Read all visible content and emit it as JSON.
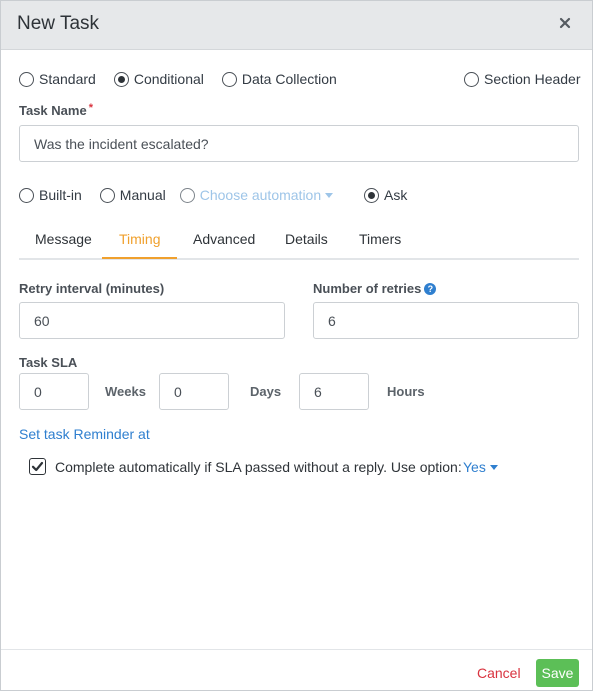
{
  "dialog": {
    "title": "New Task"
  },
  "task_type": {
    "options": [
      "Standard",
      "Conditional",
      "Data Collection",
      "Section Header"
    ],
    "selected": "Conditional"
  },
  "task_name": {
    "label": "Task Name",
    "required_mark": "*",
    "value": "Was the incident escalated?"
  },
  "mode": {
    "options": [
      "Built-in",
      "Manual",
      "Choose automation",
      "Ask"
    ],
    "selected": "Ask"
  },
  "tabs": {
    "items": [
      "Message",
      "Timing",
      "Advanced",
      "Details",
      "Timers"
    ],
    "active": "Timing"
  },
  "timing": {
    "retry_label": "Retry interval (minutes)",
    "retry_value": "60",
    "retries_label": "Number of retries",
    "retries_value": "6",
    "sla_label": "Task SLA",
    "weeks_value": "0",
    "weeks_unit": "Weeks",
    "days_value": "0",
    "days_unit": "Days",
    "hours_value": "6",
    "hours_unit": "Hours",
    "reminder_link": "Set task Reminder at",
    "auto_complete_text": "Complete automatically if SLA passed without a reply. Use option:",
    "auto_complete_checked": true,
    "auto_complete_option": "Yes"
  },
  "footer": {
    "cancel_label": "Cancel",
    "save_label": "Save"
  },
  "colors": {
    "accent": "#f0a02d",
    "link": "#2f7fcf",
    "save": "#5cbf57",
    "cancel": "#d9333f"
  }
}
